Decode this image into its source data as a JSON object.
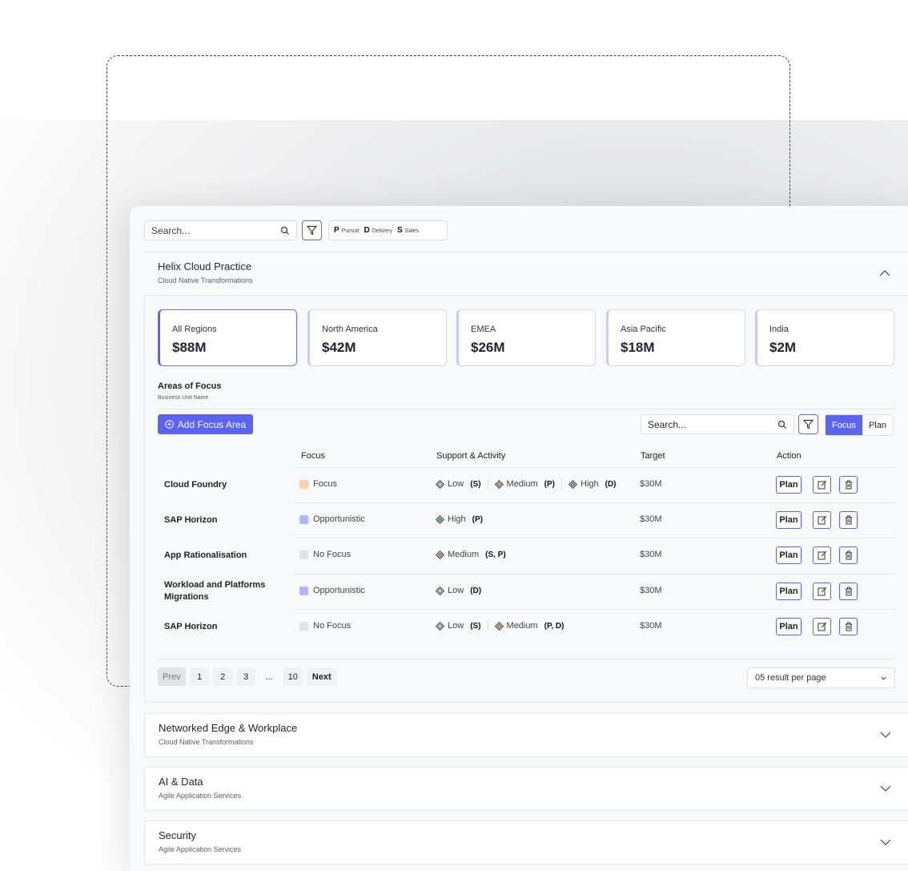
{
  "toolbar": {
    "search_placeholder": "Search...",
    "legend": [
      {
        "key": "P",
        "label": "Pursuit"
      },
      {
        "key": "D",
        "label": "Delivery"
      },
      {
        "key": "S",
        "label": "Sales"
      }
    ]
  },
  "practice": {
    "title": "Helix Cloud Practice",
    "subtitle": "Cloud Native Transformations"
  },
  "regions": [
    {
      "label": "All Regions",
      "value": "$88M",
      "active": true
    },
    {
      "label": "North America",
      "value": "$42M"
    },
    {
      "label": "EMEA",
      "value": "$26M"
    },
    {
      "label": "Asia Pacific",
      "value": "$18M"
    },
    {
      "label": "India",
      "value": "$2M"
    }
  ],
  "areas": {
    "title": "Areas of Focus",
    "subtitle": "Business Unit Name",
    "add_label": "Add Focus Area",
    "search_placeholder": "Search...",
    "toggle": {
      "focus": "Focus",
      "plan": "Plan"
    },
    "columns": {
      "focus": "Focus",
      "support": "Support & Activity",
      "target": "Target",
      "action": "Action"
    },
    "rows": [
      {
        "name": "Cloud Foundry",
        "focus": "Focus",
        "focus_color": "#fbd0a3",
        "target": "$30M",
        "plan": "Plan",
        "support": [
          {
            "level": "Low",
            "tag": "(S)"
          },
          {
            "level": "Medium",
            "tag": "(P)"
          },
          {
            "level": "High",
            "tag": "(D)"
          }
        ]
      },
      {
        "name": "SAP Horizon",
        "focus": "Opportunistic",
        "focus_color": "#b3b7f5",
        "target": "$30M",
        "plan": "Plan",
        "support": [
          {
            "level": "High",
            "tag": "(P)"
          }
        ]
      },
      {
        "name": "App Rationalisation",
        "focus": "No Focus",
        "focus_color": "#e3e4e6",
        "target": "$30M",
        "plan": "Plan",
        "support": [
          {
            "level": "Medium",
            "tag": "(S, P)"
          }
        ]
      },
      {
        "name": "Workload and Platforms Migrations",
        "focus": "Opportunistic",
        "focus_color": "#b3b7f5",
        "target": "$30M",
        "plan": "Plan",
        "support": [
          {
            "level": "Low",
            "tag": "(D)"
          }
        ]
      },
      {
        "name": "SAP Horizon",
        "focus": "No Focus",
        "focus_color": "#e3e4e6",
        "target": "$30M",
        "plan": "Plan",
        "support": [
          {
            "level": "Low",
            "tag": "(S)"
          },
          {
            "level": "Medium",
            "tag": "(P, D)"
          }
        ]
      }
    ]
  },
  "pager": {
    "prev": "Prev",
    "pages": [
      "1",
      "2",
      "3"
    ],
    "ellipsis": "...",
    "last": "10",
    "next": "Next",
    "per_page": "05 result per page"
  },
  "collapsed_sections": [
    {
      "title": "Networked Edge & Workplace",
      "subtitle": "Cloud Native Transformations"
    },
    {
      "title": "AI & Data",
      "subtitle": "Agile Application Services"
    },
    {
      "title": "Security",
      "subtitle": "Agile Application Services"
    }
  ],
  "colors": {
    "accent": "#5b63f2",
    "low": "#ffffff",
    "medium": "#f6b26b",
    "high": "#6fcf86"
  }
}
